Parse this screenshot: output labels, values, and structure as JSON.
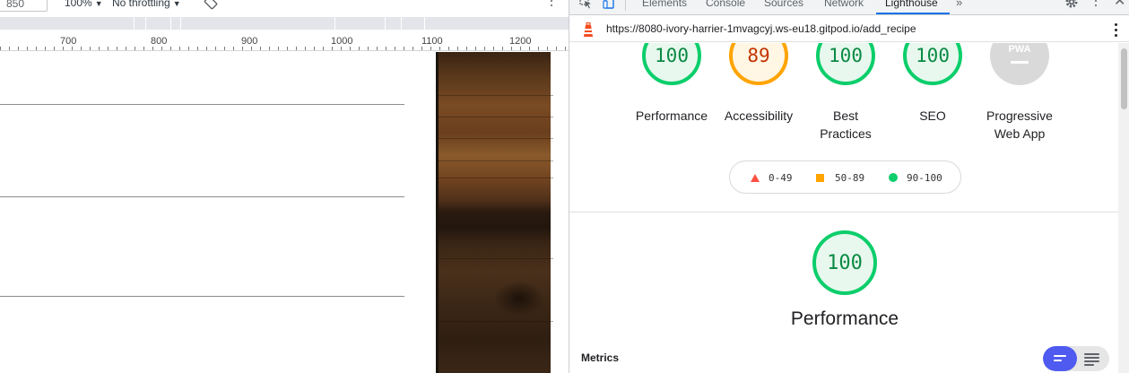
{
  "device_toolbar": {
    "width_value": "850",
    "zoom": "100%",
    "throttling": "No throttling",
    "icons": [
      "rotate-icon",
      "kebab-menu-icon"
    ]
  },
  "ruler": {
    "labels": [
      "700",
      "800",
      "900",
      "1000",
      "1100",
      "1200"
    ]
  },
  "devtools": {
    "tabs": [
      {
        "label": "Elements"
      },
      {
        "label": "Console"
      },
      {
        "label": "Sources"
      },
      {
        "label": "Network"
      },
      {
        "label": "Lighthouse"
      }
    ],
    "active_tab": "Lighthouse",
    "more_tabs": "»",
    "icons": [
      "inspect-element-icon",
      "device-toolbar-icon",
      "gear-icon",
      "kebab-menu-icon",
      "close-icon"
    ]
  },
  "lighthouse": {
    "url": "https://8080-ivory-harrier-1mvagcyj.ws-eu18.gitpod.io/add_recipe",
    "categories": [
      {
        "score": "100",
        "label_line1": "Performance",
        "label_line2": "",
        "status": "pass"
      },
      {
        "score": "89",
        "label_line1": "Accessibility",
        "label_line2": "",
        "status": "average"
      },
      {
        "score": "100",
        "label_line1": "Best",
        "label_line2": "Practices",
        "status": "pass"
      },
      {
        "score": "100",
        "label_line1": "SEO",
        "label_line2": "",
        "status": "pass"
      },
      {
        "score": "",
        "badge": "PWA",
        "label_line1": "Progressive",
        "label_line2": "Web App",
        "status": "na"
      }
    ],
    "legend": [
      {
        "range": "0-49",
        "color": "#ff4e42",
        "shape": "triangle"
      },
      {
        "range": "50-89",
        "color": "#ffa400",
        "shape": "square"
      },
      {
        "range": "90-100",
        "color": "#0cce6b",
        "shape": "circle"
      }
    ],
    "performance": {
      "score": "100",
      "title": "Performance"
    },
    "metrics_label": "Metrics"
  },
  "colors": {
    "pass": "#0cce6b",
    "average": "#ffa400",
    "fail": "#ff4e42",
    "accent": "#1a73e8",
    "toggle_active": "#4f5bf0"
  }
}
